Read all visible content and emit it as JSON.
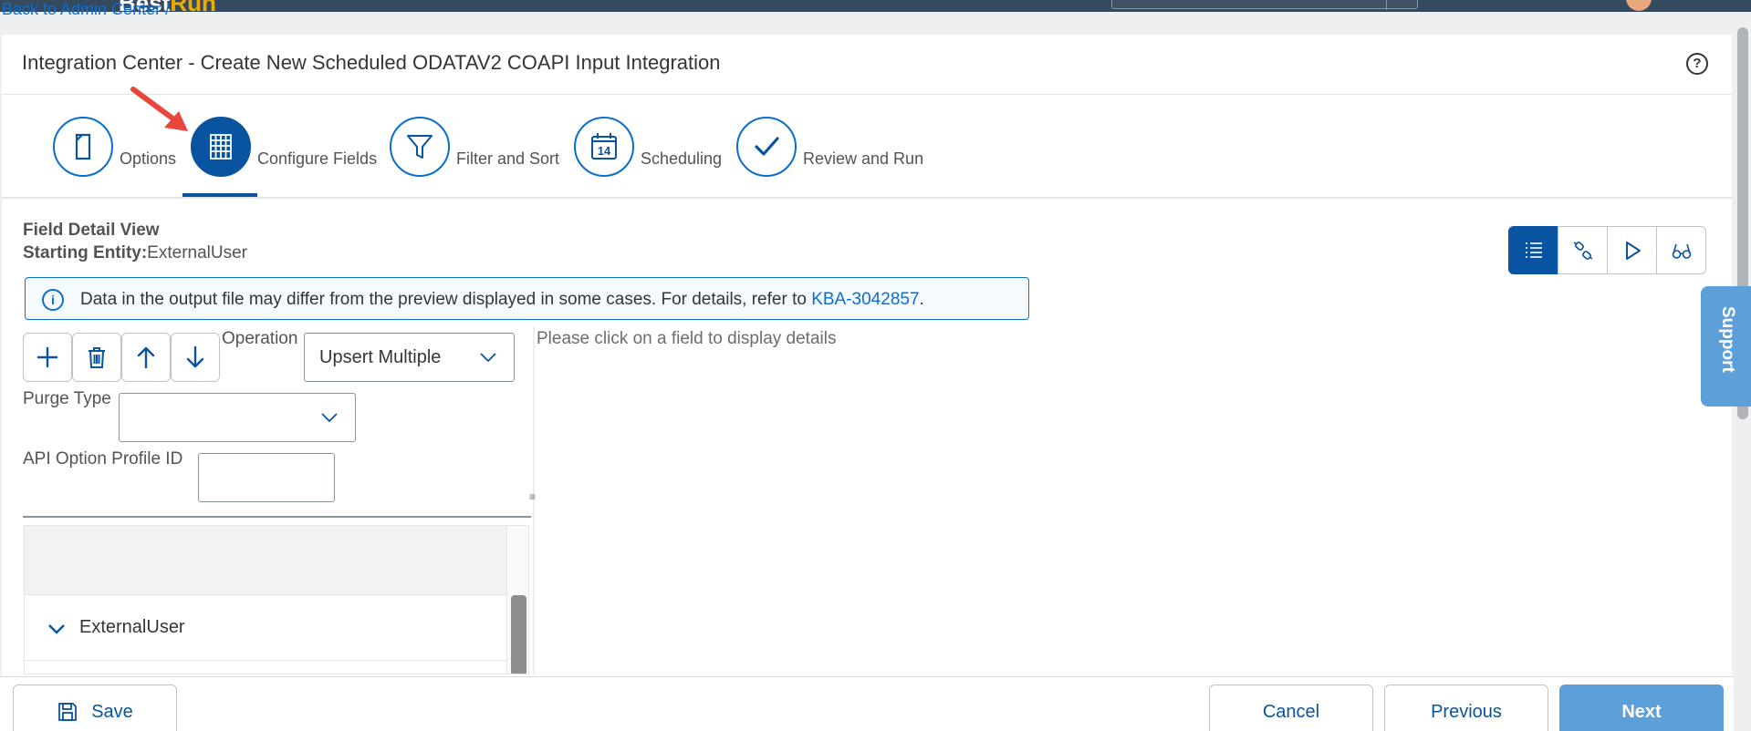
{
  "header": {
    "logo": "Best",
    "logo_accent": "Run"
  },
  "back_link": "Back to Admin Center /",
  "title": "Integration Center - Create New Scheduled ODATAV2 COAPI Input Integration",
  "help_icon": "?",
  "wizard": {
    "steps": [
      {
        "label": "Options",
        "icon": "document-icon",
        "active": false
      },
      {
        "label": "Configure Fields",
        "icon": "grid-icon",
        "active": true
      },
      {
        "label": "Filter and Sort",
        "icon": "filter-icon",
        "active": false
      },
      {
        "label": "Scheduling",
        "icon": "calendar-icon",
        "active": false,
        "calendar_day": "14"
      },
      {
        "label": "Review and Run",
        "icon": "checkmark-icon",
        "active": false
      }
    ]
  },
  "field_view": {
    "title": "Field Detail View",
    "starting_entity_label": "Starting Entity:",
    "starting_entity_value": "ExternalUser"
  },
  "view_buttons": [
    "list-icon",
    "link-icon",
    "play-icon",
    "glasses-icon"
  ],
  "info": {
    "message": "Data in the output file may differ from the preview displayed in some cases. For details, refer to ",
    "link": "KBA-3042857",
    "suffix": "."
  },
  "toolbar": [
    "add-icon",
    "delete-icon",
    "move-up-icon",
    "move-down-icon"
  ],
  "form": {
    "operation_label": "Operation",
    "operation_value": "Upsert Multiple",
    "purge_label": "Purge Type",
    "purge_value": "",
    "api_label": "API Option Profile ID",
    "api_value": ""
  },
  "detail_hint": "Please click on a field to display details",
  "tree": {
    "root": "ExternalUser"
  },
  "support": "Support",
  "footer": {
    "save": "Save",
    "cancel": "Cancel",
    "previous": "Previous",
    "next": "Next"
  },
  "colors": {
    "primary": "#0854a0",
    "accent_blue": "#0a6ed1",
    "next_button": "#5d9fd8",
    "shell": "#354a5f",
    "arrow": "#e8453c"
  }
}
